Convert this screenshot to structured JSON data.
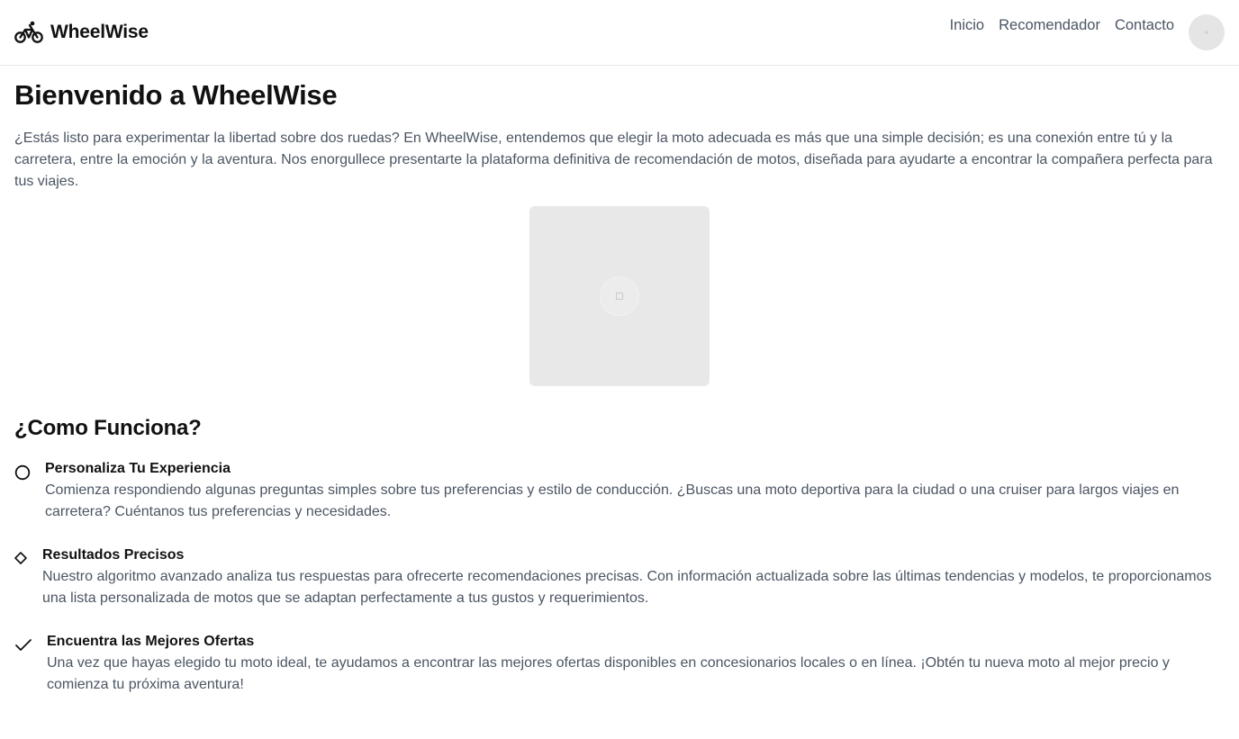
{
  "header": {
    "brand": "WheelWise",
    "brand_icon": "bicycle-icon",
    "nav": [
      {
        "label": "Inicio"
      },
      {
        "label": "Recomendador"
      },
      {
        "label": "Contacto"
      }
    ]
  },
  "hero": {
    "title": "Bienvenido a WheelWise",
    "intro": "¿Estás listo para experimentar la libertad sobre dos ruedas? En WheelWise, entendemos que elegir la moto adecuada es más que una simple decisión; es una conexión entre tú y la carretera, entre la emoción y la aventura. Nos enorgullece presentarte la plataforma definitiva de recomendación de motos, diseñada para ayudarte a encontrar la compañera perfecta para tus viajes."
  },
  "how_it_works": {
    "title": "¿Como Funciona?",
    "steps": [
      {
        "icon": "circle-icon",
        "title": "Personaliza Tu Experiencia",
        "description": "Comienza respondiendo algunas preguntas simples sobre tus preferencias y estilo de conducción. ¿Buscas una moto deportiva para la ciudad o una cruiser para largos viajes en carretera? Cuéntanos tus preferencias y necesidades."
      },
      {
        "icon": "diamond-icon",
        "title": "Resultados Precisos",
        "description": "Nuestro algoritmo avanzado analiza tus respuestas para ofrecerte recomendaciones precisas. Con información actualizada sobre las últimas tendencias y modelos, te proporcionamos una lista personalizada de motos que se adaptan perfectamente a tus gustos y requerimientos."
      },
      {
        "icon": "check-icon",
        "title": "Encuentra las Mejores Ofertas",
        "description": "Una vez que hayas elegido tu moto ideal, te ayudamos a encontrar las mejores ofertas disponibles en concesionarios locales o en línea. ¡Obtén tu nueva moto al mejor precio y comienza tu próxima aventura!"
      }
    ]
  }
}
